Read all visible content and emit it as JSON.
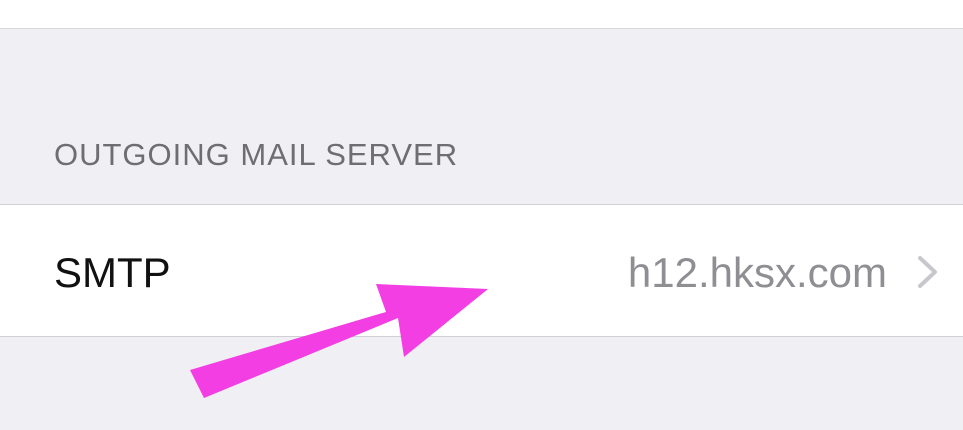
{
  "section": {
    "header": "OUTGOING MAIL SERVER"
  },
  "smtp_cell": {
    "label": "SMTP",
    "value": "h12.hksx.com",
    "disclosure_icon": "chevron-right-icon"
  },
  "annotation": {
    "icon": "arrow-annotation",
    "color": "#f23ee3"
  },
  "colors": {
    "background": "#efeff4",
    "cell": "#ffffff",
    "header_text": "#6d6d72",
    "label_text": "#111111",
    "value_text": "#8e8e93"
  }
}
